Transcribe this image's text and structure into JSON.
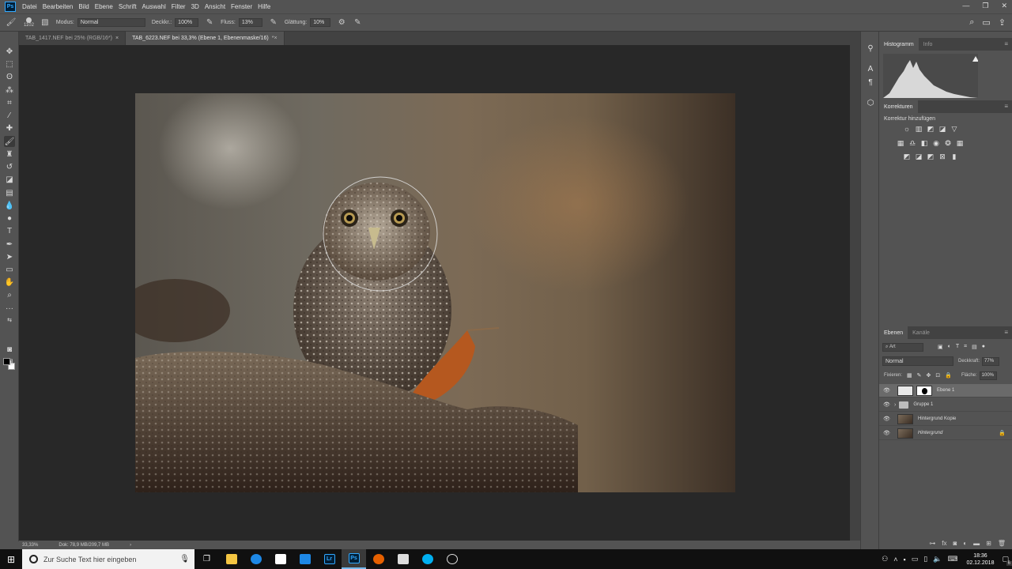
{
  "app": {
    "logo": "Ps"
  },
  "menu": [
    "Datei",
    "Bearbeiten",
    "Bild",
    "Ebene",
    "Schrift",
    "Auswahl",
    "Filter",
    "3D",
    "Ansicht",
    "Fenster",
    "Hilfe"
  ],
  "options": {
    "brush_size": "1102",
    "mode_label": "Modus:",
    "mode_value": "Normal",
    "opacity_label": "Deckkr.:",
    "opacity_value": "100%",
    "flow_label": "Fluss:",
    "flow_value": "13%",
    "smoothing_label": "Glättung:",
    "smoothing_value": "10%"
  },
  "tabs": [
    {
      "label": "TAB_1417.NEF bei 25% (RGB/16*)",
      "close": "×"
    },
    {
      "label": "TAB_6223.NEF bei 33,3% (Ebene 1, Ebenenmaske/16)",
      "close": "*×"
    }
  ],
  "status": {
    "zoom": "33,33%",
    "doc": "Dok: 78,9 MB/209,7 MB"
  },
  "panels": {
    "histogram_tab": "Histogramm",
    "info_tab": "Info",
    "adjustments_tab": "Korrekturen",
    "adjustments_title": "Korrektur hinzufügen",
    "layers_tab": "Ebenen",
    "channels_tab": "Kanäle",
    "filter_kind": "Art",
    "blend_mode": "Normal",
    "opacity_label": "Deckkraft:",
    "opacity_value": "77%",
    "lock_label": "Fixieren:",
    "fill_label": "Fläche:",
    "fill_value": "100%"
  },
  "layers": [
    {
      "name": "Ebene 1",
      "selected": true
    },
    {
      "name": "Gruppe 1"
    },
    {
      "name": "Hintergrund Kopie"
    },
    {
      "name": "Hintergrund",
      "locked": true
    }
  ],
  "taskbar": {
    "search_placeholder": "Zur Suche Text hier eingeben",
    "time": "18:36",
    "date": "02.12.2018",
    "notifications": "6"
  },
  "colors": {
    "accent": "#31a8ff",
    "photoshop_bg": "#001e36",
    "canvas_bg": "#282828"
  }
}
